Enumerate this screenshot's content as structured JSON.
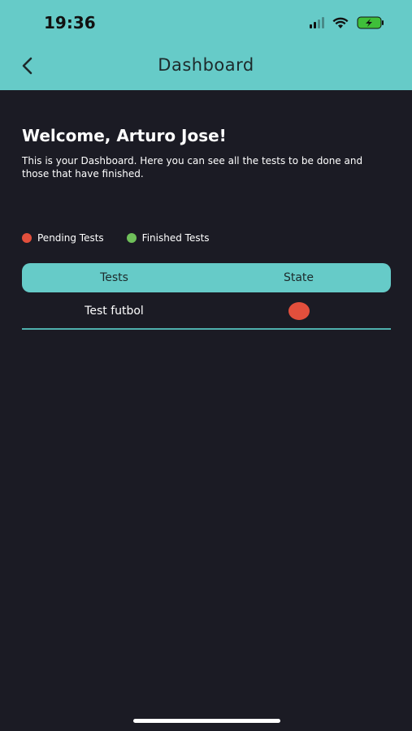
{
  "status_bar": {
    "time": "19:36"
  },
  "nav": {
    "title": "Dashboard",
    "back_icon": "chevron-left-icon"
  },
  "main": {
    "welcome": "Welcome, Arturo Jose!",
    "description": "This is your Dashboard. Here you can see all the tests to be done and those that have finished."
  },
  "legend": [
    {
      "label": "Pending Tests",
      "color": "#e24f3c"
    },
    {
      "label": "Finished Tests",
      "color": "#6fbf5a"
    }
  ],
  "table": {
    "headers": [
      "Tests",
      "State"
    ],
    "rows": [
      {
        "name": "Test futbol",
        "state": "pending",
        "state_color": "#e24f3c"
      }
    ]
  },
  "colors": {
    "accent": "#66cbc8",
    "background": "#1b1b24"
  }
}
